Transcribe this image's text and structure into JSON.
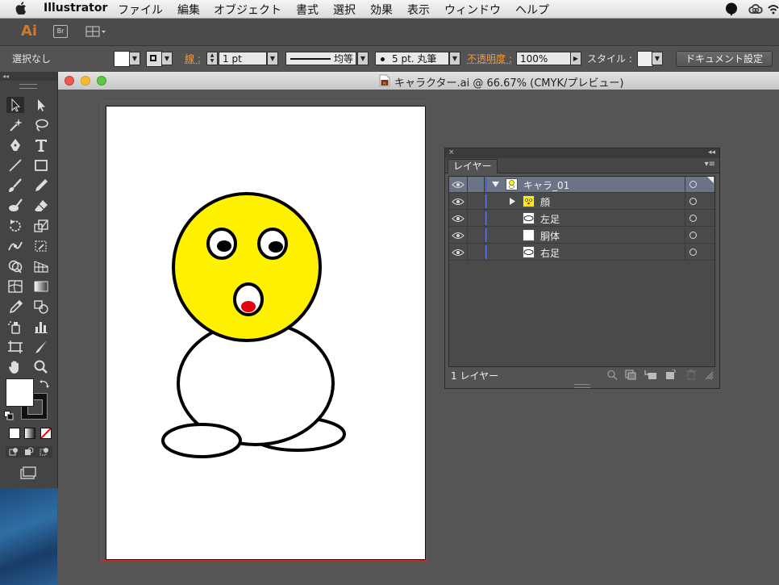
{
  "menubar": {
    "app_name": "Illustrator",
    "items": [
      "ファイル",
      "編集",
      "オブジェクト",
      "書式",
      "選択",
      "効果",
      "表示",
      "ウィンドウ",
      "ヘルプ"
    ]
  },
  "appbar": {
    "logo": "Ai",
    "bridge": "Br"
  },
  "controlbar": {
    "selection": "選択なし",
    "stroke_label": "線 :",
    "stroke_weight": "1 pt",
    "stroke_profile": "均等",
    "brush": "5 pt. 丸筆",
    "opacity_label": "不透明度 :",
    "opacity_value": "100%",
    "style_label": "スタイル :",
    "document_settings": "ドキュメント設定"
  },
  "document": {
    "title": "キャラクター.ai @ 66.67% (CMYK/プレビュー)"
  },
  "layers_panel": {
    "tab": "レイヤー",
    "rows": [
      {
        "name": "キャラ_01",
        "type": "layer",
        "expanded": true,
        "selected": true
      },
      {
        "name": "顔",
        "type": "group",
        "expanded": false,
        "selected": false
      },
      {
        "name": "左足",
        "type": "ellipse",
        "selected": false
      },
      {
        "name": "胴体",
        "type": "blank",
        "selected": false
      },
      {
        "name": "右足",
        "type": "ellipse",
        "selected": false
      }
    ],
    "footer": "1 レイヤー"
  },
  "colors": {
    "face": "#FFF200",
    "mouth_red": "#E8000D",
    "layer_color": "#4B5FD6",
    "orange_labels": "#F39A3C"
  }
}
